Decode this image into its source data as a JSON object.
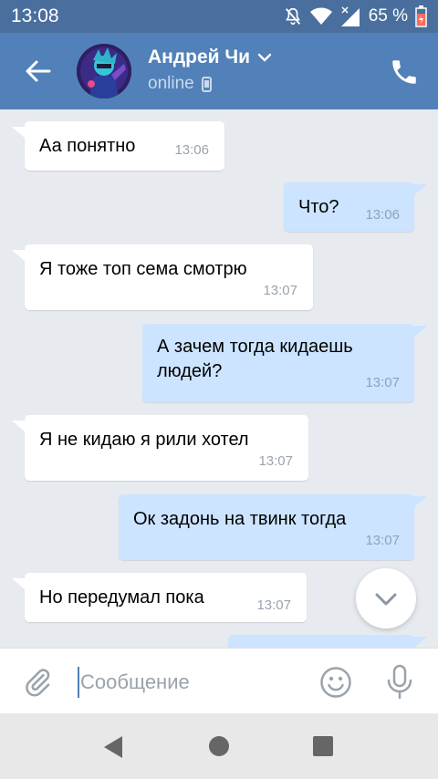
{
  "status_bar": {
    "time": "13:08",
    "battery": "65 %"
  },
  "header": {
    "name": "Андрей Чи",
    "status": "online"
  },
  "messages": [
    {
      "dir": "in",
      "text": "Аа понятно",
      "time": "13:06"
    },
    {
      "dir": "out",
      "text": "Что?",
      "time": "13:06"
    },
    {
      "dir": "in",
      "text": "Я тоже топ сема смотрю",
      "time": "13:07"
    },
    {
      "dir": "out",
      "text_line1": "А зачем тогда кидаешь",
      "text_line2": "людей?",
      "time": "13:07"
    },
    {
      "dir": "in",
      "text": "Я не кидаю я рили хотел",
      "time": "13:07"
    },
    {
      "dir": "out",
      "text": "Ок задонь на твинк тогда",
      "time": "13:07"
    },
    {
      "dir": "in",
      "text": "Но передумал пока",
      "time": "13:07"
    }
  ],
  "composer": {
    "placeholder": "Сообщение"
  },
  "colors": {
    "header": "#5181b8",
    "status_bar": "#4a6f9e",
    "outgoing_bubble": "#cce4ff",
    "incoming_bubble": "#ffffff",
    "background": "#e7ebf0"
  },
  "icons": [
    "mute-icon",
    "wifi-icon",
    "signal-icon",
    "battery-icon",
    "back-arrow-icon",
    "chevron-down-icon",
    "phone-device-icon",
    "phone-call-icon",
    "scroll-down-icon",
    "attach-icon",
    "emoji-icon",
    "mic-icon",
    "nav-back-icon",
    "nav-home-icon",
    "nav-recent-icon"
  ]
}
